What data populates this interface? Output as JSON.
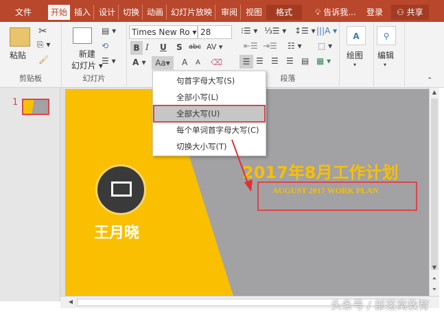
{
  "tabs": {
    "file": "文件",
    "home": "开始",
    "insert": "插入",
    "design": "设计",
    "transitions": "切换",
    "animations": "动画",
    "slideshow": "幻灯片放映",
    "review": "审阅",
    "view": "视图",
    "format": "格式",
    "tellme": "告诉我...",
    "signin": "登录",
    "share": "共享"
  },
  "ribbon": {
    "clipboard": {
      "label": "剪贴板",
      "paste": "粘贴"
    },
    "slides": {
      "label": "幻灯片",
      "new_slide_1": "新建",
      "new_slide_2": "幻灯片"
    },
    "font": {
      "name": "Times New Ro",
      "size": "28",
      "bold": "B",
      "italic": "I",
      "underline": "U",
      "shadow": "S",
      "strike": "abc",
      "spacing": "AV",
      "color": "A",
      "case": "Aa",
      "grow": "A",
      "shrink": "A"
    },
    "paragraph": {
      "label": "段落"
    },
    "drawing": {
      "label": "绘图"
    },
    "editing": {
      "label": "编辑"
    }
  },
  "case_menu": {
    "items": [
      "句首字母大写(S)",
      "全部小写(L)",
      "全部大写(U)",
      "每个单词首字母大写(C)",
      "切换大小写(T)"
    ],
    "selected_index": 2
  },
  "thumbnails": {
    "slide_number": "1"
  },
  "slide": {
    "name": "王月晓",
    "title": "2017年8月工作计划",
    "subtitle": "AUGUST 2017 WORK PLAN"
  },
  "watermark": "头条号 / 部落窝教育",
  "colors": {
    "accent": "#b9472b",
    "yellow": "#f9bf00",
    "highlight": "#d9474a"
  }
}
